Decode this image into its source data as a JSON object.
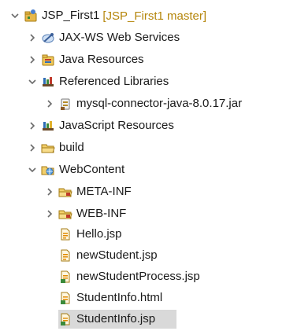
{
  "project_explorer": {
    "project": {
      "label": "JSP_First1",
      "decoration": "[JSP_First1 master]",
      "icon": "project-icon"
    },
    "items": [
      {
        "label": "JAX-WS Web Services",
        "icon": "jaxws-services-icon",
        "state": "collapsed"
      },
      {
        "label": "Java Resources",
        "icon": "java-resources-icon",
        "state": "collapsed"
      },
      {
        "label": "Referenced Libraries",
        "icon": "library-icon",
        "state": "expanded"
      },
      {
        "label": "mysql-connector-java-8.0.17.jar",
        "icon": "jar-icon",
        "state": "collapsed"
      },
      {
        "label": "JavaScript Resources",
        "icon": "javascript-resources-icon",
        "state": "collapsed"
      },
      {
        "label": "build",
        "icon": "folder-icon",
        "state": "collapsed"
      },
      {
        "label": "WebContent",
        "icon": "web-folder-icon",
        "state": "expanded"
      },
      {
        "label": "META-INF",
        "icon": "folder-icon",
        "state": "collapsed"
      },
      {
        "label": "WEB-INF",
        "icon": "folder-icon",
        "state": "collapsed"
      },
      {
        "label": "Hello.jsp",
        "icon": "jsp-file-icon"
      },
      {
        "label": "newStudent.jsp",
        "icon": "jsp-file-icon"
      },
      {
        "label": "newStudentProcess.jsp",
        "icon": "jsp-file-icon"
      },
      {
        "label": "StudentInfo.html",
        "icon": "html-file-icon"
      },
      {
        "label": "StudentInfo.jsp",
        "icon": "jsp-file-icon",
        "selected": true
      }
    ],
    "colors": {
      "selection": "#d9d9d9",
      "decoration": "#b5860b",
      "folder": "#e8b84a"
    }
  }
}
